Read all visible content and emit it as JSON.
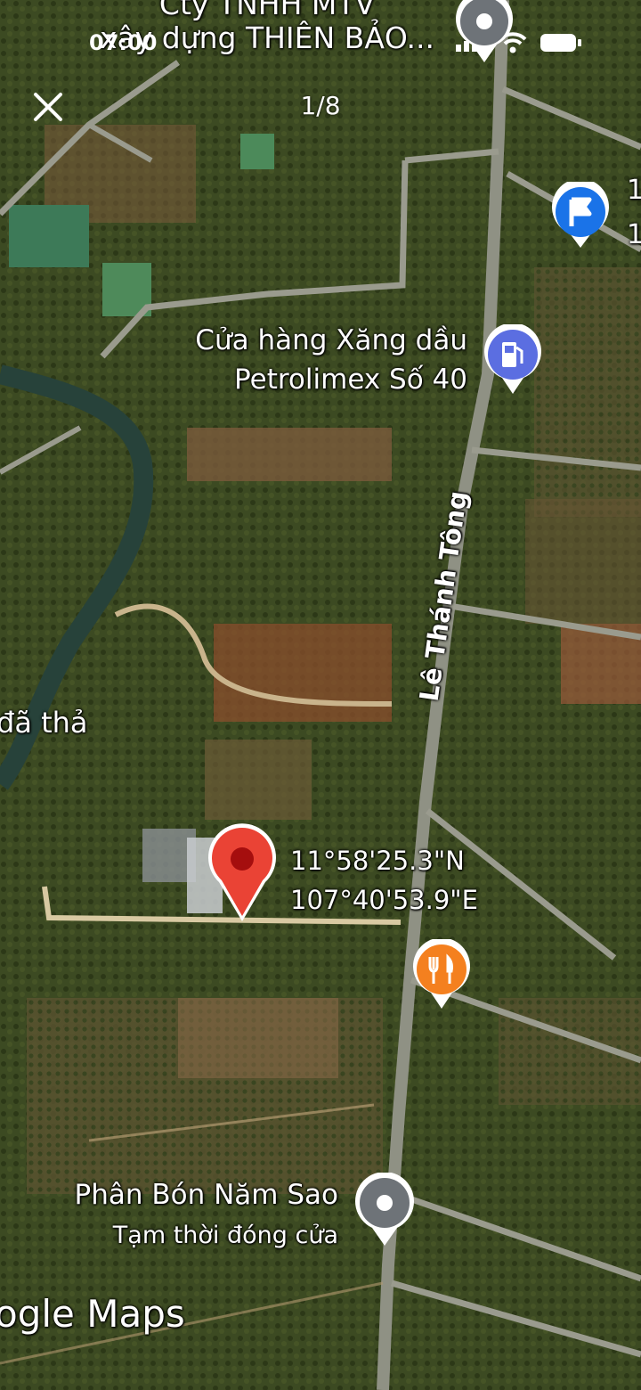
{
  "status_bar": {
    "time": "07:00"
  },
  "viewer": {
    "counter": "1/8",
    "close_icon": "close-icon"
  },
  "places": {
    "top_company": {
      "line1": "Cty TNHH MTV",
      "line2": "xây dựng THIÊN BẢO..."
    },
    "gas_station": {
      "line1": "Cửa hàng Xăng dầu",
      "line2": "Petrolimex Số 40",
      "icon": "fuel-pump-icon",
      "color": "#5b6ee1"
    },
    "fertilizer": {
      "line1": "Phân Bón Năm Sao",
      "line2": "Tạm thời đóng cửa",
      "icon": "place-dot-icon"
    },
    "restaurant": {
      "icon": "fork-knife-icon",
      "color": "#f4801f"
    },
    "parking": {
      "icon": "parking-flag-icon",
      "color": "#1a73e8",
      "partial_text_1": "1",
      "partial_text_2": "1"
    },
    "left_partial": "đã thả"
  },
  "road": {
    "name": "Lê Thánh Tông"
  },
  "dropped_pin": {
    "lat": "11°58'25.3\"N",
    "lng": "107°40'53.9\"E",
    "color": "#ea4335"
  },
  "brand": {
    "text": "ogle Maps"
  }
}
